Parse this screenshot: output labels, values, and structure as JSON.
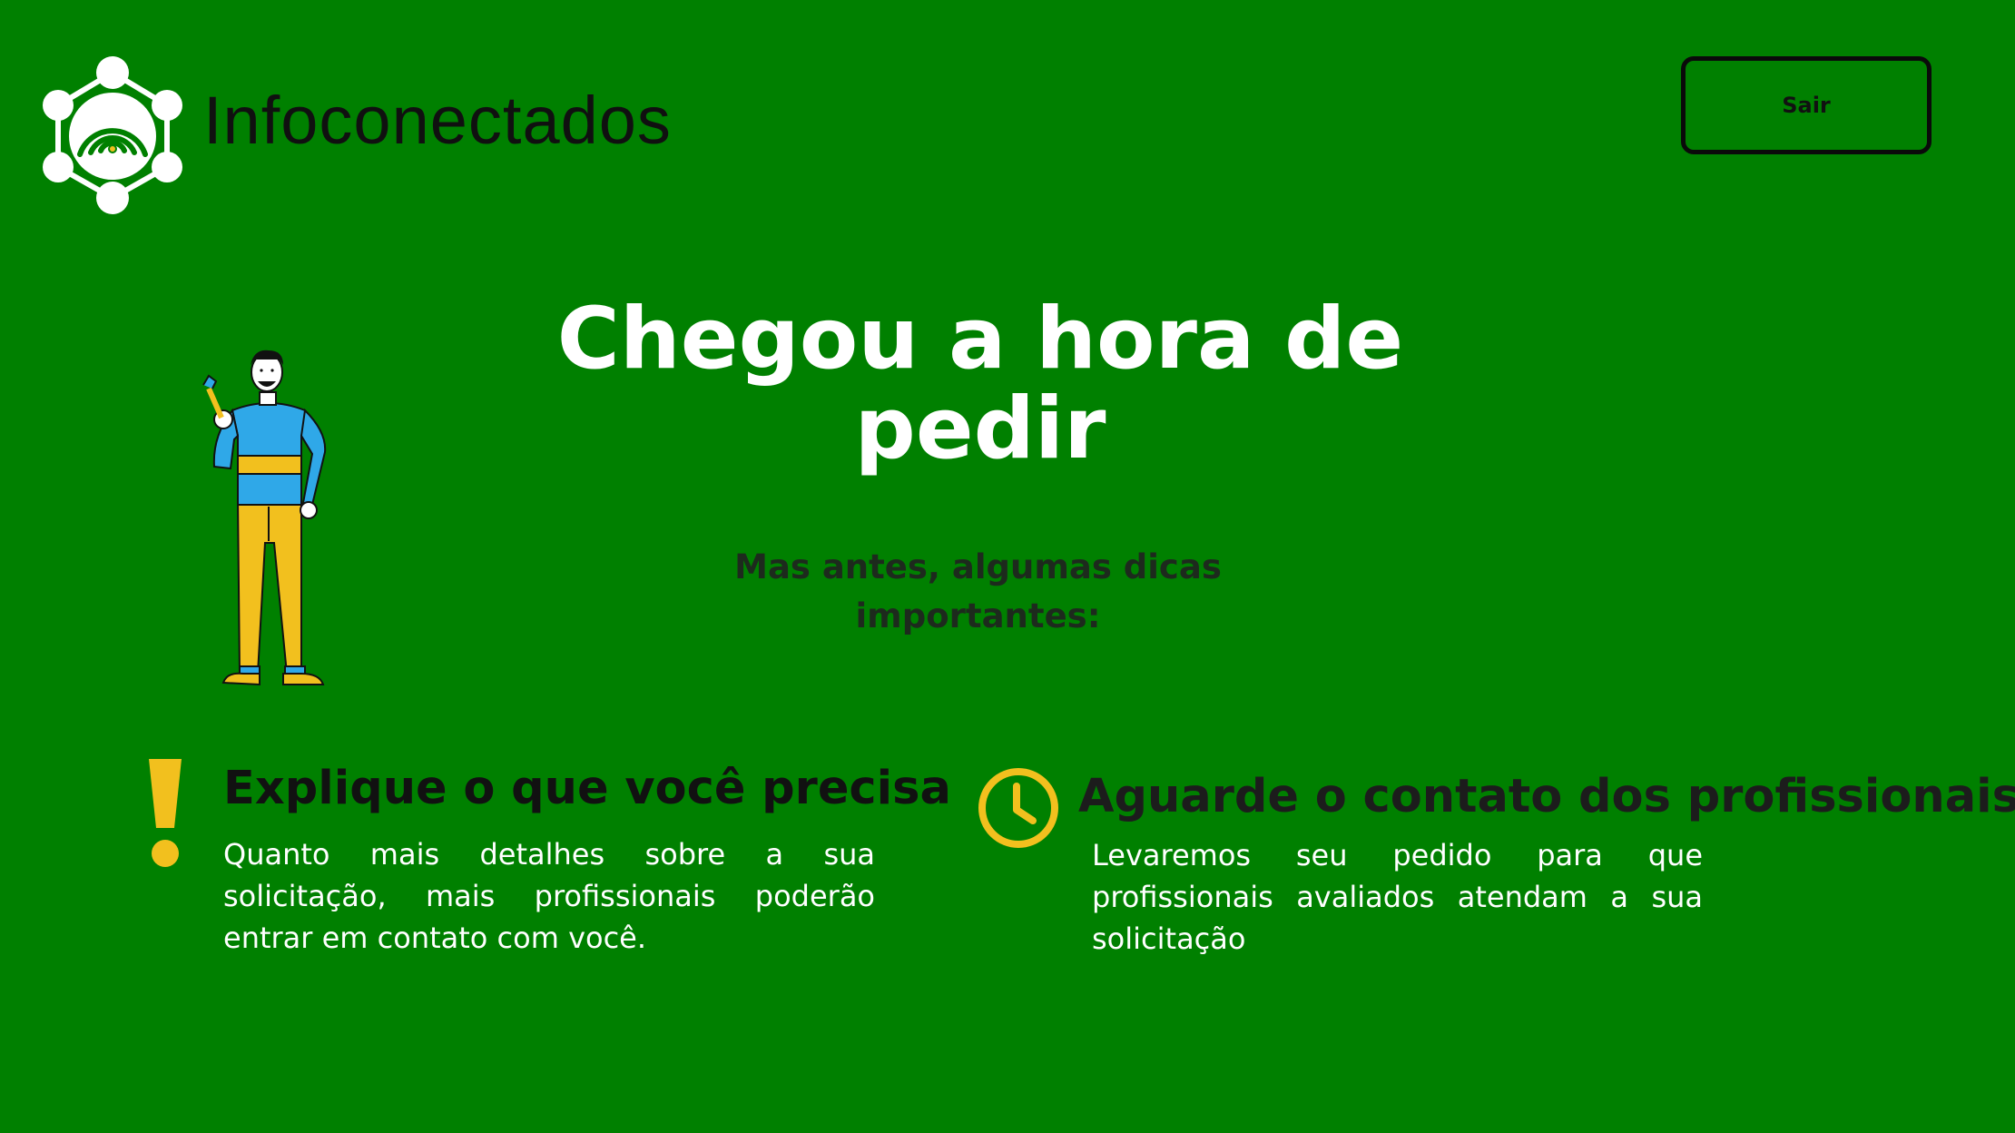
{
  "header": {
    "brand_name": "Infoconectados",
    "logo_icon": "network-hub-icon",
    "exit_label": "Sair"
  },
  "hero": {
    "title": "Chegou a hora de pedir",
    "subtitle": "Mas antes, algumas dicas importantes:",
    "illustration": "man-holding-wrench-illustration"
  },
  "tips": [
    {
      "icon": "exclamation-icon",
      "heading": "Explique o que você precisa",
      "body": "Quanto mais detalhes sobre a sua solicitação, mais profissionais poderão entrar em contato com você."
    },
    {
      "icon": "clock-icon",
      "heading": "Aguarde o contato dos profissionais",
      "body": "Levaremos seu pedido para que profissionais avaliados atendam a sua solicitação"
    }
  ],
  "colors": {
    "background": "#008000",
    "accent_yellow": "#F2C01E",
    "shirt_blue": "#2FA8E8",
    "text_dark": "#111111",
    "text_light": "#FFFFFF"
  }
}
